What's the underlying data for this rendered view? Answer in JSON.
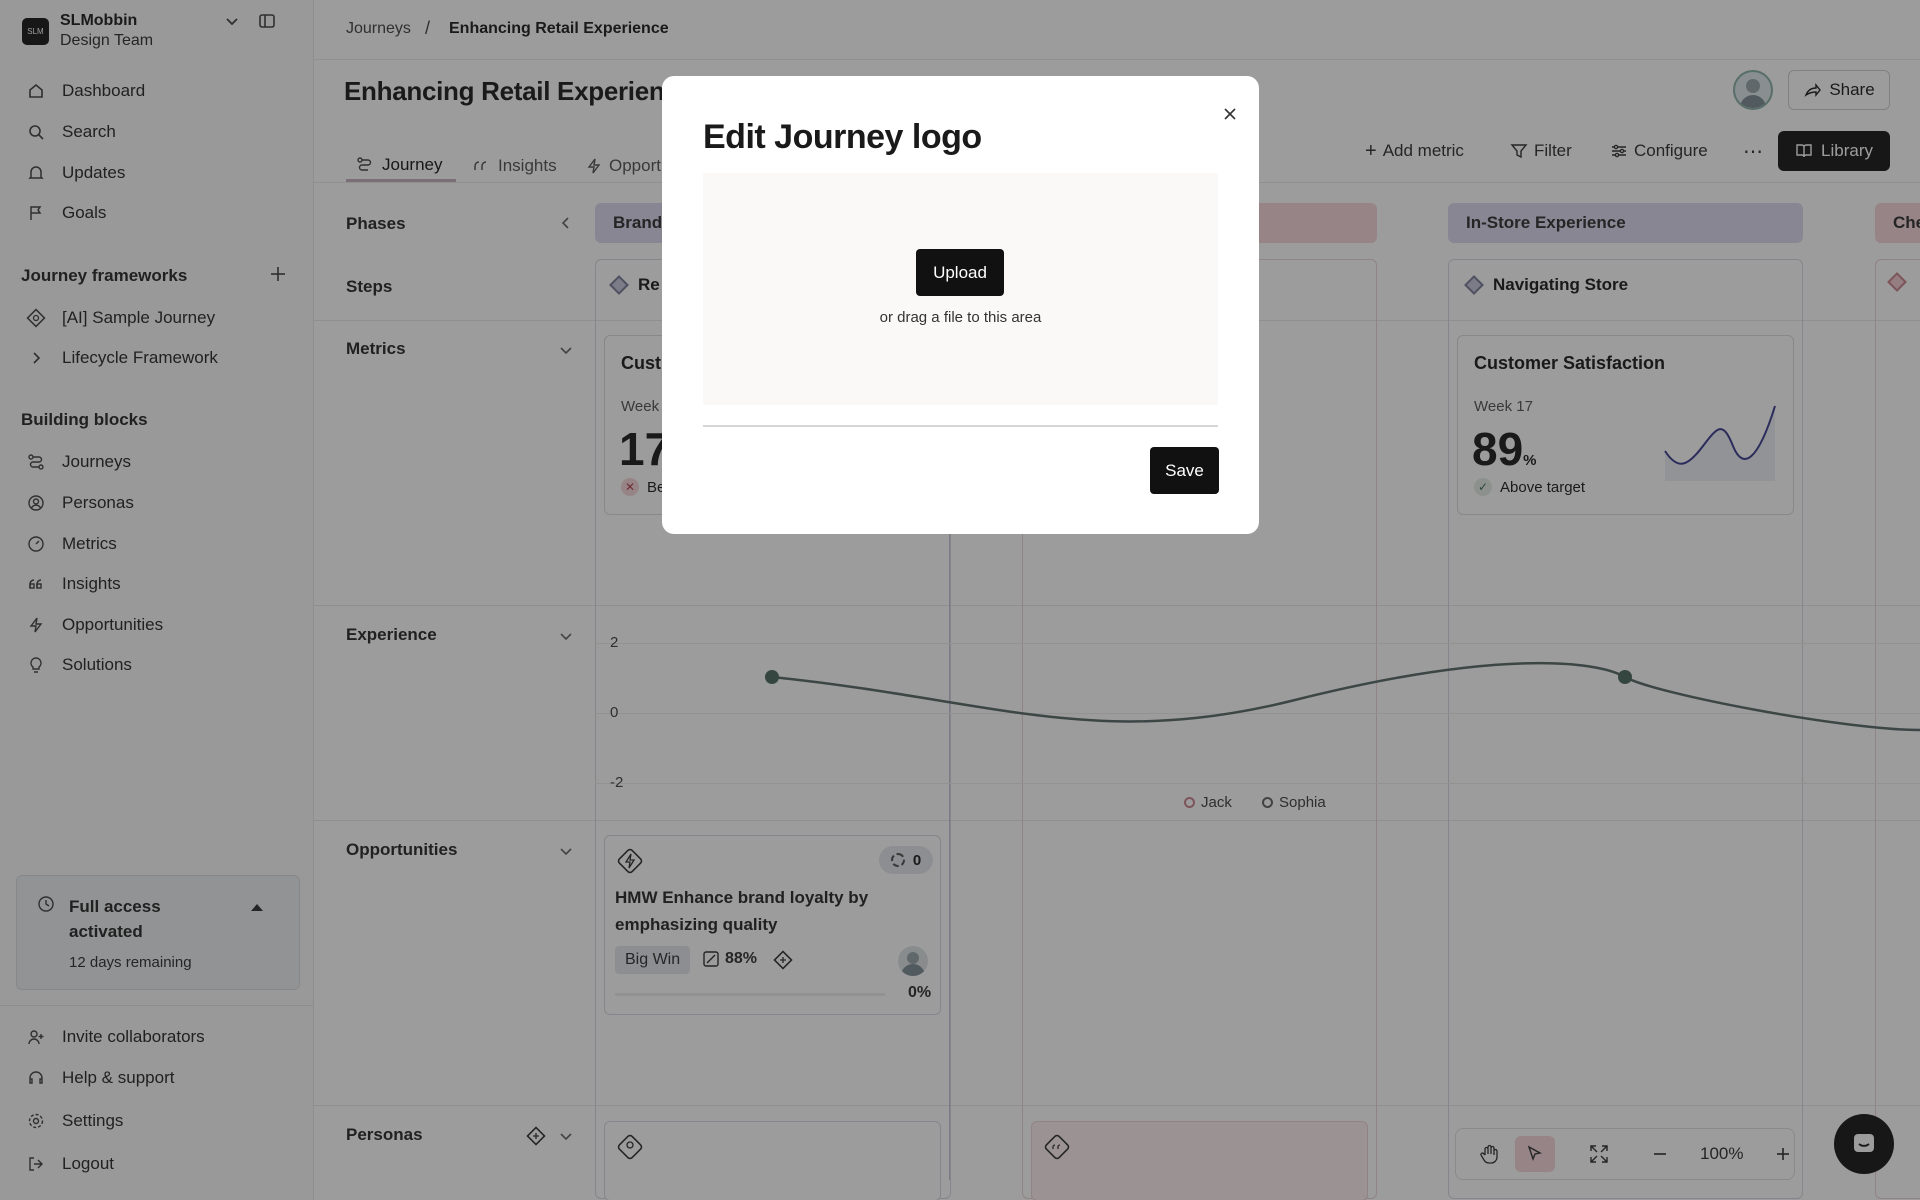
{
  "sidebar": {
    "team_logo": "SLM",
    "team_name": "SLMobbin",
    "team_sub": "Design Team",
    "nav": [
      {
        "label": "Dashboard",
        "icon": "home-icon"
      },
      {
        "label": "Search",
        "icon": "search-icon"
      },
      {
        "label": "Updates",
        "icon": "bell-icon"
      },
      {
        "label": "Goals",
        "icon": "flag-icon"
      }
    ],
    "frameworks_title": "Journey frameworks",
    "frameworks": [
      {
        "label": "[AI] Sample Journey",
        "icon": "ai-diamond-icon"
      },
      {
        "label": "Lifecycle Framework",
        "icon": "chevron-right-icon"
      }
    ],
    "blocks_title": "Building blocks",
    "blocks": [
      {
        "label": "Journeys",
        "icon": "route-icon"
      },
      {
        "label": "Personas",
        "icon": "persona-icon"
      },
      {
        "label": "Metrics",
        "icon": "gauge-icon"
      },
      {
        "label": "Insights",
        "icon": "quote-icon"
      },
      {
        "label": "Opportunities",
        "icon": "bolt-icon"
      },
      {
        "label": "Solutions",
        "icon": "bulb-icon"
      }
    ],
    "trial_title": "Full access activated",
    "trial_sub": "12 days remaining",
    "footer": [
      {
        "label": "Invite collaborators",
        "icon": "user-plus-icon"
      },
      {
        "label": "Help & support",
        "icon": "help-icon"
      },
      {
        "label": "Settings",
        "icon": "gear-icon"
      },
      {
        "label": "Logout",
        "icon": "logout-icon"
      }
    ]
  },
  "topbar": {
    "crumb_root": "Journeys",
    "crumb_sep": "/",
    "crumb_current": "Enhancing Retail Experience",
    "share": "Share"
  },
  "page": {
    "title": "Enhancing Retail Experienc",
    "tabs": [
      "Journey",
      "Insights",
      "Opport"
    ],
    "tools": [
      "Add metric",
      "Filter",
      "Configure"
    ],
    "more": "⋯",
    "library": "Library"
  },
  "rows": {
    "phases": "Phases",
    "steps": "Steps",
    "metrics": "Metrics",
    "experience": "Experience",
    "opportunities": "Opportunities",
    "personas": "Personas"
  },
  "phases": [
    {
      "label": "Brand",
      "color": "#dcdaf0"
    },
    {
      "label": "",
      "color": "#f6d6da"
    },
    {
      "label": "In-Store Experience",
      "color": "#dcdaf0"
    },
    {
      "label": "Che",
      "color": "#f6d6da"
    }
  ],
  "steps": [
    {
      "label": "Re"
    },
    {
      "label": "Navigating Store"
    }
  ],
  "metric_cards": [
    {
      "title": "Cust",
      "week": "Week",
      "value": "17",
      "unit": "",
      "status": "Be",
      "status_icon": "x-icon"
    },
    {
      "title": "Customer Satisfaction",
      "week": "Week 17",
      "value": "89",
      "unit": "%",
      "status": "Above target",
      "status_icon": "check-icon"
    }
  ],
  "experience": {
    "ticks": [
      "2",
      "0",
      "-2"
    ],
    "legend": [
      {
        "name": "Jack",
        "color": "#c9848e"
      },
      {
        "name": "Sophia",
        "color": "#666"
      }
    ]
  },
  "opportunity": {
    "count": "0",
    "title": "HMW Enhance brand loyalty by emphasizing quality",
    "tag": "Big Win",
    "score": "88%",
    "progress": 0,
    "progress_label": "0%"
  },
  "bottom": {
    "zoom": "100%"
  },
  "modal": {
    "title": "Edit Journey logo",
    "upload": "Upload",
    "drag_hint": "or drag a file to this area",
    "save": "Save"
  }
}
